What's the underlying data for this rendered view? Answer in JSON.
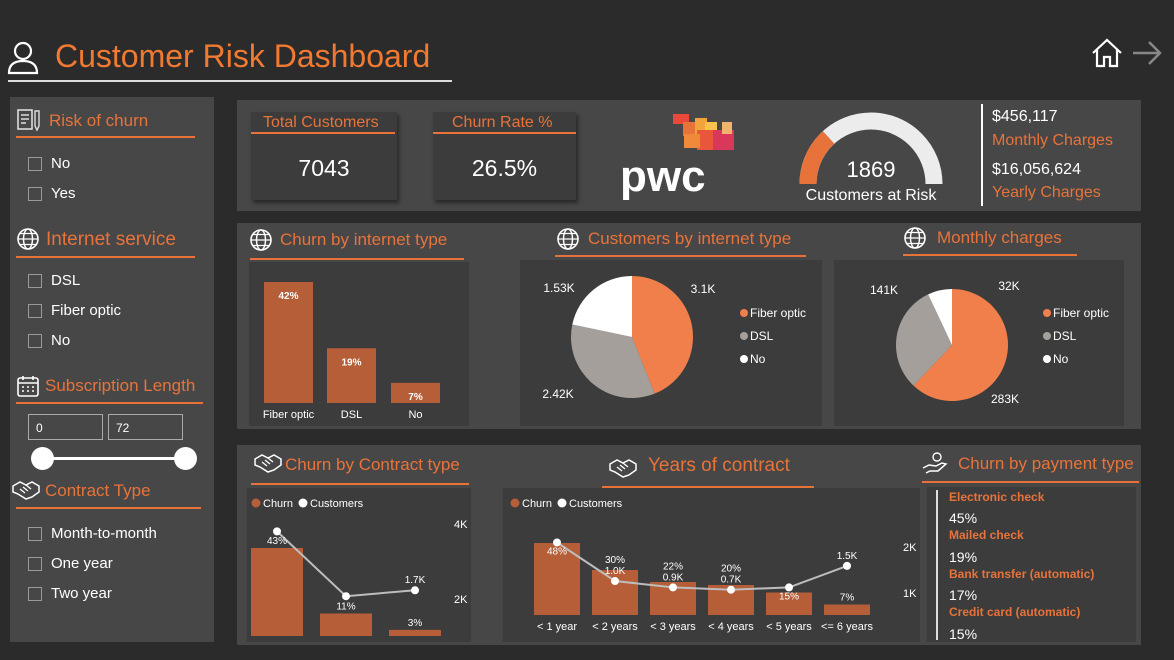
{
  "header": {
    "title": "Customer Risk Dashboard",
    "icons": {
      "user": "user-icon",
      "home": "home-icon",
      "next": "arrow-right-icon"
    }
  },
  "sidebar": {
    "risk": {
      "title": "Risk of churn",
      "options": [
        "No",
        "Yes"
      ]
    },
    "internet": {
      "title": "Internet service",
      "options": [
        "DSL",
        "Fiber optic",
        "No"
      ]
    },
    "subscription": {
      "title": "Subscription Length",
      "min": "0",
      "max": "72"
    },
    "contract": {
      "title": "Contract Type",
      "options": [
        "Month-to-month",
        "One year",
        "Two year"
      ]
    }
  },
  "kpis": {
    "total_customers": {
      "label": "Total Customers",
      "value": "7043"
    },
    "churn_rate": {
      "label": "Churn Rate %",
      "value": "26.5%"
    },
    "logo_text": "pwc",
    "at_risk": {
      "value": "1869",
      "label": "Customers at Risk",
      "fraction": 0.265
    },
    "monthly": {
      "value": "$456,117",
      "label": "Monthly Charges"
    },
    "yearly": {
      "value": "$16,056,624",
      "label": "Yearly Charges"
    }
  },
  "colors": {
    "accent": "#e8733a",
    "bar": "#b55e38",
    "pie_gray": "#a59f9c",
    "pie_white": "#ffffff",
    "panel": "#474747",
    "background": "#2b2b2b"
  },
  "sections": {
    "churn_internet": "Churn by internet type",
    "customers_internet": "Customers by internet type",
    "monthly_charges": "Monthly charges",
    "churn_contract": "Churn by Contract type",
    "years_contract": "Years of contract",
    "churn_payment": "Churn by payment type"
  },
  "legend": {
    "churn": "Churn",
    "customers": "Customers",
    "fiber": "Fiber optic",
    "dsl": "DSL",
    "no": "No"
  },
  "payment": [
    {
      "name": "Electronic check",
      "value": "45%"
    },
    {
      "name": "Mailed check",
      "value": "19%"
    },
    {
      "name": "Bank transfer (automatic)",
      "value": "17%"
    },
    {
      "name": "Credit card (automatic)",
      "value": "15%"
    }
  ],
  "chart_data": [
    {
      "id": "churn_by_internet",
      "type": "bar",
      "title": "Churn by internet type",
      "categories": [
        "Fiber optic",
        "DSL",
        "No"
      ],
      "values": [
        42,
        19,
        7
      ],
      "data_labels": [
        "42%",
        "19%",
        "7%"
      ],
      "ylim": [
        0,
        42
      ]
    },
    {
      "id": "customers_by_internet",
      "type": "pie",
      "title": "Customers by internet type",
      "labels": [
        "Fiber optic",
        "DSL",
        "No"
      ],
      "values": [
        3100,
        2420,
        1530
      ],
      "data_labels": [
        "3.1K",
        "2.42K",
        "1.53K"
      ],
      "colors": [
        "#f07f4c",
        "#a59f9c",
        "#ffffff"
      ],
      "legend": "right"
    },
    {
      "id": "monthly_charges",
      "type": "pie",
      "title": "Monthly charges",
      "labels": [
        "Fiber optic",
        "DSL",
        "No"
      ],
      "values": [
        283000,
        141000,
        32000
      ],
      "data_labels": [
        "283K",
        "141K",
        "32K"
      ],
      "colors": [
        "#f07f4c",
        "#a59f9c",
        "#ffffff"
      ],
      "legend": "right"
    },
    {
      "id": "churn_by_contract",
      "type": "bar",
      "title": "Churn by Contract type",
      "categories": [
        "Month-to-month",
        "One year",
        "Two year"
      ],
      "series": [
        {
          "name": "Churn",
          "kind": "bar",
          "values": [
            43,
            11,
            3
          ],
          "labels": [
            "43%",
            "11%",
            "3%"
          ]
        },
        {
          "name": "Customers",
          "kind": "line",
          "values": [
            3875,
            1473,
            1695
          ],
          "labels": [
            "",
            "",
            "1.7K"
          ]
        }
      ],
      "y_ticks": [
        "4K",
        "2K"
      ],
      "legend": "top-left"
    },
    {
      "id": "years_of_contract",
      "type": "bar",
      "title": "Years of contract",
      "categories": [
        "< 1 year",
        "< 2 years",
        "< 3 years",
        "< 4 years",
        "< 5 years",
        "<= 6 years"
      ],
      "series": [
        {
          "name": "Churn",
          "kind": "bar",
          "values": [
            48,
            30,
            22,
            20,
            15,
            7
          ],
          "labels": [
            "48%",
            "30%",
            "22%",
            "20%",
            "15%",
            "7%"
          ]
        },
        {
          "name": "Customers",
          "kind": "line",
          "values": [
            2186,
            1024,
            832,
            762,
            832,
            1480
          ],
          "labels": [
            "",
            "1.0K",
            "0.9K",
            "0.7K",
            "",
            "1.5K"
          ]
        }
      ],
      "y_ticks": [
        "2K",
        "1K"
      ],
      "legend": "top-left"
    }
  ]
}
